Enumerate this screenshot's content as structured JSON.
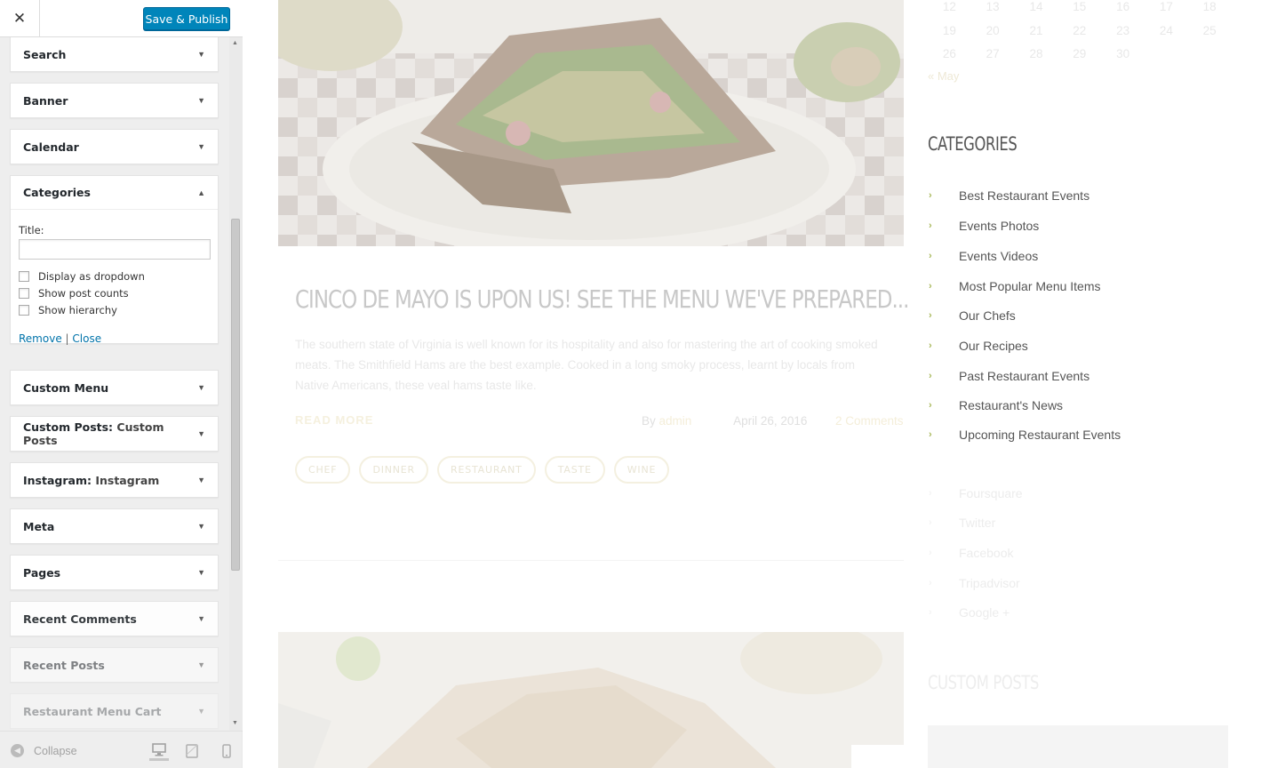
{
  "customizer": {
    "close_label": "✕",
    "publish_label": "Save & Publish",
    "widgets": [
      {
        "title": "Search",
        "sub": "",
        "expanded": false
      },
      {
        "title": "Banner",
        "sub": "",
        "expanded": false
      },
      {
        "title": "Calendar",
        "sub": "",
        "expanded": false
      },
      {
        "title": "Categories",
        "sub": "",
        "expanded": true
      },
      {
        "title": "Custom Menu",
        "sub": "",
        "expanded": false
      },
      {
        "title": "Custom Posts:",
        "sub": "Custom Posts",
        "expanded": false
      },
      {
        "title": "Instagram:",
        "sub": "Instagram",
        "expanded": false
      },
      {
        "title": "Meta",
        "sub": "",
        "expanded": false
      },
      {
        "title": "Pages",
        "sub": "",
        "expanded": false
      },
      {
        "title": "Recent Comments",
        "sub": "",
        "expanded": false
      },
      {
        "title": "Recent Posts",
        "sub": "",
        "expanded": false
      },
      {
        "title": "Restaurant Menu Cart",
        "sub": "",
        "expanded": false
      }
    ],
    "categories_form": {
      "title_label": "Title:",
      "title_value": "",
      "checkboxes": [
        {
          "label": "Display as dropdown",
          "checked": false
        },
        {
          "label": "Show post counts",
          "checked": false
        },
        {
          "label": "Show hierarchy",
          "checked": false
        }
      ],
      "remove_label": "Remove",
      "separator": "|",
      "close_label": "Close"
    },
    "footer": {
      "collapse_label": "Collapse",
      "devices": [
        "desktop-icon",
        "tablet-icon",
        "mobile-icon"
      ],
      "active_device": "desktop"
    }
  },
  "preview": {
    "post": {
      "title": "CINCO DE MAYO IS UPON US! SEE THE MENU WE'VE PREPARED...",
      "excerpt": "The southern state of Virginia is well known for its hospitality and also for mastering the art of cooking smoked meats. The Smithfield Hams are the best example. Cooked in a long smoky process, learnt by locals from Native Americans, these veal hams taste like.",
      "read_more": "READ MORE",
      "by_label": "By",
      "author": "admin",
      "date": "April 26, 2016",
      "comments": "2 Comments",
      "tags": [
        "CHEF",
        "DINNER",
        "RESTAURANT",
        "TASTE",
        "WINE"
      ]
    },
    "calendar": {
      "rows": [
        [
          "12",
          "13",
          "14",
          "15",
          "16",
          "17",
          "18"
        ],
        [
          "19",
          "20",
          "21",
          "22",
          "23",
          "24",
          "25"
        ],
        [
          "26",
          "27",
          "28",
          "29",
          "30",
          "",
          ""
        ]
      ],
      "prev_link": "« May"
    },
    "categories": {
      "heading": "CATEGORIES",
      "items": [
        "Best Restaurant Events",
        "Events Photos",
        "Events Videos",
        "Most Popular Menu Items",
        "Our Chefs",
        "Our Recipes",
        "Past Restaurant Events",
        "Restaurant's News",
        "Upcoming Restaurant Events"
      ]
    },
    "social": [
      "Foursquare",
      "Twitter",
      "Facebook",
      "Tripadvisor",
      "Google +"
    ],
    "custom_posts_heading": "CUSTOM POSTS",
    "colors": {
      "publish_button": "#0085ba",
      "link": "#0073aa",
      "bullet_accent": "#a8b85a",
      "tag_accent": "#f4f0e0"
    }
  }
}
